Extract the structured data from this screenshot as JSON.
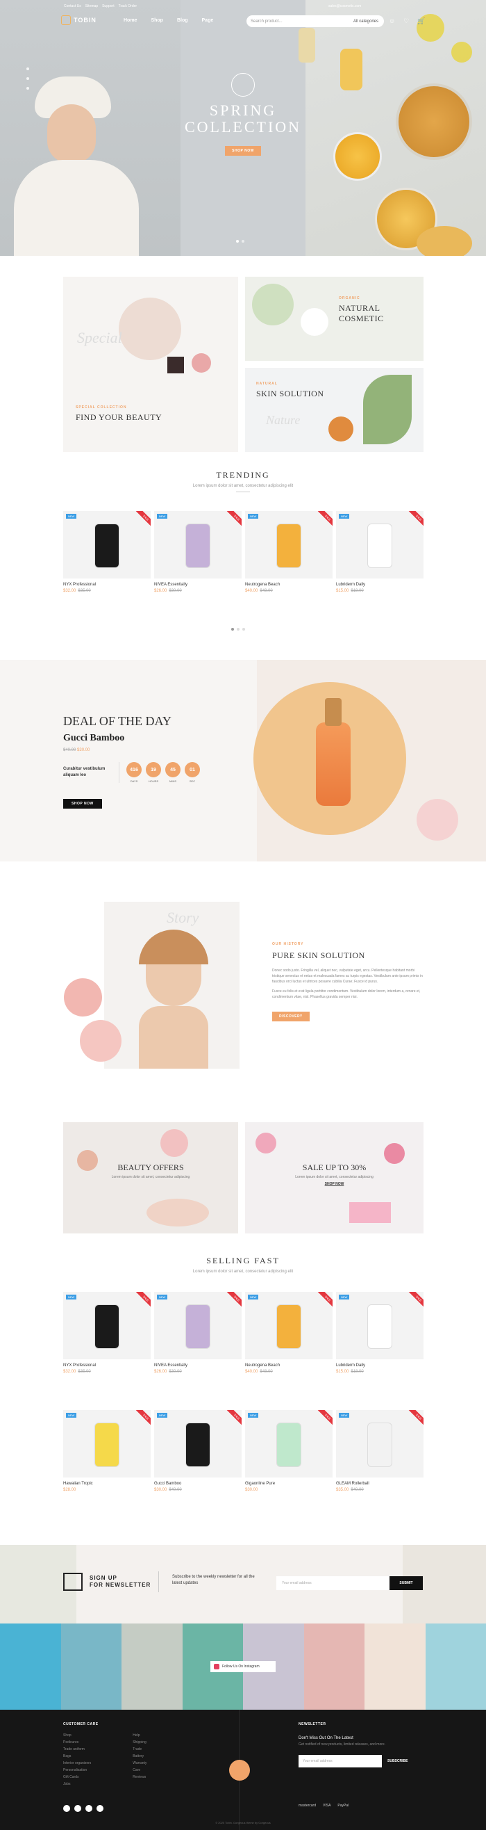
{
  "topbar": {
    "links": [
      "Contact Us",
      "Sitemap",
      "Support",
      "Track Order"
    ],
    "email": "sales@cosmetic.com"
  },
  "nav": {
    "logo": "TOBIN",
    "menu": [
      "Home",
      "Shop",
      "Blog",
      "Page"
    ],
    "search_placeholder": "Search product...",
    "search_category": "All categories"
  },
  "hero": {
    "title_line1": "SPRING",
    "title_line2": "COLLECTION",
    "button": "SHOP NOW"
  },
  "banners": [
    {
      "sub": "SPECIAL COLLECTION",
      "title": "FIND YOUR BEAUTY",
      "script": "Special"
    },
    {
      "sub": "ORGANIC",
      "title": "NATURAL COSMETIC"
    },
    {
      "sub": "NATURAL",
      "title": "SKIN SOLUTION",
      "script": "Nature"
    }
  ],
  "trending": {
    "title": "TRENDING",
    "desc": "Lorem ipsum dolor sit amet, consectetur adipiscing elit"
  },
  "products_trending": [
    {
      "name": "NYX Professional",
      "price": "$32.00",
      "old": "$35.00"
    },
    {
      "name": "NIVEA Essentially",
      "price": "$26.00",
      "old": "$30.00"
    },
    {
      "name": "Neutrogena Beach",
      "price": "$40.00",
      "old": "$48.00"
    },
    {
      "name": "Lubriderm Daily",
      "price": "$15.00",
      "old": "$18.00"
    }
  ],
  "deal": {
    "title": "DEAL OF THE DAY",
    "product": "Gucci Bamboo",
    "old": "$40.00",
    "price": "$30.00",
    "desc_line1": "Curabitur vestibulum",
    "desc_line2": "aliquam leo",
    "countdown": [
      {
        "v": "416",
        "l": "DAYS"
      },
      {
        "v": "19",
        "l": "HOURS"
      },
      {
        "v": "45",
        "l": "MINS"
      },
      {
        "v": "01",
        "l": "SEC"
      }
    ],
    "button": "SHOP NOW"
  },
  "story": {
    "script": "Story",
    "sub": "OUR HISTORY",
    "title": "PURE SKIN SOLUTION",
    "p1": "Donec sodo justo. Fringilla vel, aliquet nec, vulputate eget, arcu. Pellentesque habitant morbi tristique senectus et netus et malesuada fames ac turpis egestas. Vestibulum ante ipsum primis in faucibus orci luctus et ultrices posuere cubilia Curae; Fusce id purus.",
    "p2": "Fusce eu felis et erat ligula porttitor condimentum. Vestibulum dolor lorem, interdum a, ornare et, condimentum vitae, nisl. Phasellus gravida semper nisi.",
    "button": "DISCOVERY"
  },
  "offers": [
    {
      "title": "BEAUTY OFFERS",
      "desc": "Lorem ipsum dolor sit amet, consectetur adipiscing",
      "link": ""
    },
    {
      "title": "SALE UP TO 30%",
      "desc": "Lorem ipsum dolor sit amet, consectetur adipiscing",
      "link": "SHOP NOW"
    }
  ],
  "selling": {
    "title": "SELLING FAST",
    "desc": "Lorem ipsum dolor sit amet, consectetur adipiscing elit"
  },
  "products_selling": [
    {
      "name": "NYX Professional",
      "price": "$32.00",
      "old": "$35.00"
    },
    {
      "name": "NIVEA Essentially",
      "price": "$26.00",
      "old": "$30.00"
    },
    {
      "name": "Neutrogena Beach",
      "price": "$40.00",
      "old": "$48.00"
    },
    {
      "name": "Lubriderm Daily",
      "price": "$15.00",
      "old": "$18.00"
    },
    {
      "name": "Hawaiian Tropic",
      "price": "$28.00",
      "old": ""
    },
    {
      "name": "Gucci Bamboo",
      "price": "$30.00",
      "old": "$40.00"
    },
    {
      "name": "Gigaonline Pure",
      "price": "$30.00",
      "old": ""
    },
    {
      "name": "GLEAM Rollerball",
      "price": "$35.00",
      "old": "$40.00"
    }
  ],
  "newsletter": {
    "title_line1": "SIGN UP",
    "title_line2": "FOR NEWSLETTER",
    "desc": "Subscribe to the weekly newsletter for all the latest updates",
    "placeholder": "Your email address",
    "button": "SUBMIT"
  },
  "instagram": {
    "label": "Follow Us On Instagram"
  },
  "footer": {
    "col1_title": "CUSTOMER CARE",
    "col1a": [
      "Shop",
      "Pedicures",
      "Trade uniform",
      "Bags",
      "Interior organizers",
      "Personalisation",
      "Gift Cards",
      "Jobs"
    ],
    "col1b": [
      "Help",
      "Shipping",
      "Trade",
      "Battery",
      "Warranty",
      "Care",
      "Reviews"
    ],
    "news_title": "NEWSLETTER",
    "news_h": "Don't Miss Out On The Latest",
    "news_desc": "Get notified of new products, limited releases, and more.",
    "news_placeholder": "Your email address",
    "news_button": "SUBSCRIBE",
    "copyright": "© 2020 Tobin. Gorgeous theme by Gorgeous",
    "payments": [
      "mastercard",
      "VISA",
      "PayPal"
    ]
  },
  "colors": {
    "accent": "#f0a46a",
    "new_badge": "#3c9ee5",
    "sale_badge": "#e4373f",
    "dark": "#161616"
  }
}
